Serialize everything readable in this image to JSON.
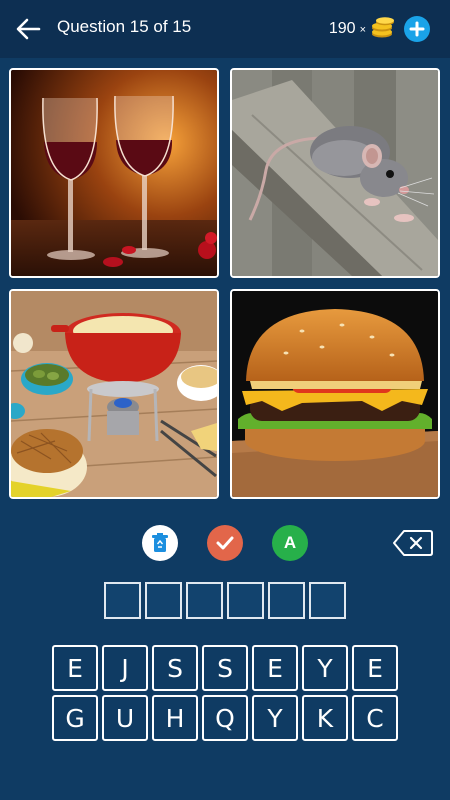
{
  "header": {
    "title": "Question 15 of 15",
    "coin_count": "190",
    "coin_multiplier": "×"
  },
  "tiles": [
    {
      "subject": "red wine glasses"
    },
    {
      "subject": "rat on wooden fence"
    },
    {
      "subject": "cheese fondue"
    },
    {
      "subject": "cheeseburger"
    }
  ],
  "hints": {
    "letter_hint_label": "A"
  },
  "answer": {
    "slots": [
      "",
      "",
      "",
      "",
      "",
      ""
    ]
  },
  "keyboard": {
    "row1": [
      "E",
      "J",
      "S",
      "S",
      "E",
      "Y",
      "E"
    ],
    "row2": [
      "G",
      "U",
      "H",
      "Q",
      "Y",
      "K",
      "C"
    ]
  },
  "colors": {
    "background": "#0f3b63",
    "header": "#0d2f52",
    "accent_blue": "#1aa3e8",
    "hint_check": "#e2664a",
    "hint_letter": "#27b04a"
  }
}
